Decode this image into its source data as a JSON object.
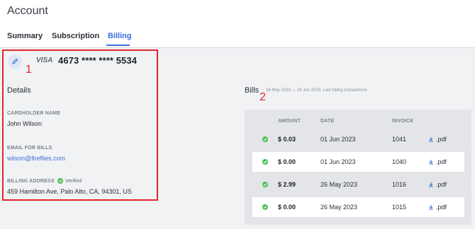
{
  "header": {
    "title": "Account",
    "tabs": [
      {
        "label": "Summary"
      },
      {
        "label": "Subscription"
      },
      {
        "label": "Billing"
      }
    ]
  },
  "card": {
    "brand": "VISA",
    "number": "4673 **** **** 5534",
    "marker": "1",
    "details_title": "Details",
    "cardholder_label": "CARDHOLDER NAME",
    "cardholder_value": "John Wilson",
    "email_label": "EMAIL FOR BILLS",
    "email_value": "wilson@fireflies.com",
    "address_label": "BILLING ADDRESS",
    "verified_label": "Verified",
    "address_value": "459 Hamilton Ave, Palo Alto, CA, 94301, US"
  },
  "bills": {
    "title": "Bills",
    "marker": "2",
    "subtitle": "26 May 2023 — 26 Jun 2023. Last billing transactions",
    "columns": {
      "amount": "AMOUNT",
      "date": "DATE",
      "invoice": "INVOICE"
    },
    "rows": [
      {
        "amount": "$ 0.03",
        "date": "01 Jun 2023",
        "invoice": "1041",
        "file": ".pdf"
      },
      {
        "amount": "$ 0.00",
        "date": "01 Jun 2023",
        "invoice": "1040",
        "file": ".pdf"
      },
      {
        "amount": "$ 2.99",
        "date": "26 May 2023",
        "invoice": "1016",
        "file": ".pdf"
      },
      {
        "amount": "$ 0.00",
        "date": "26 May 2023",
        "invoice": "1015",
        "file": ".pdf"
      }
    ]
  },
  "colors": {
    "accent": "#3a6fd8",
    "annotation": "#e3262b",
    "success": "#4bbf5a"
  },
  "icons": [
    "pencil-icon",
    "check-circle-icon",
    "download-icon"
  ]
}
